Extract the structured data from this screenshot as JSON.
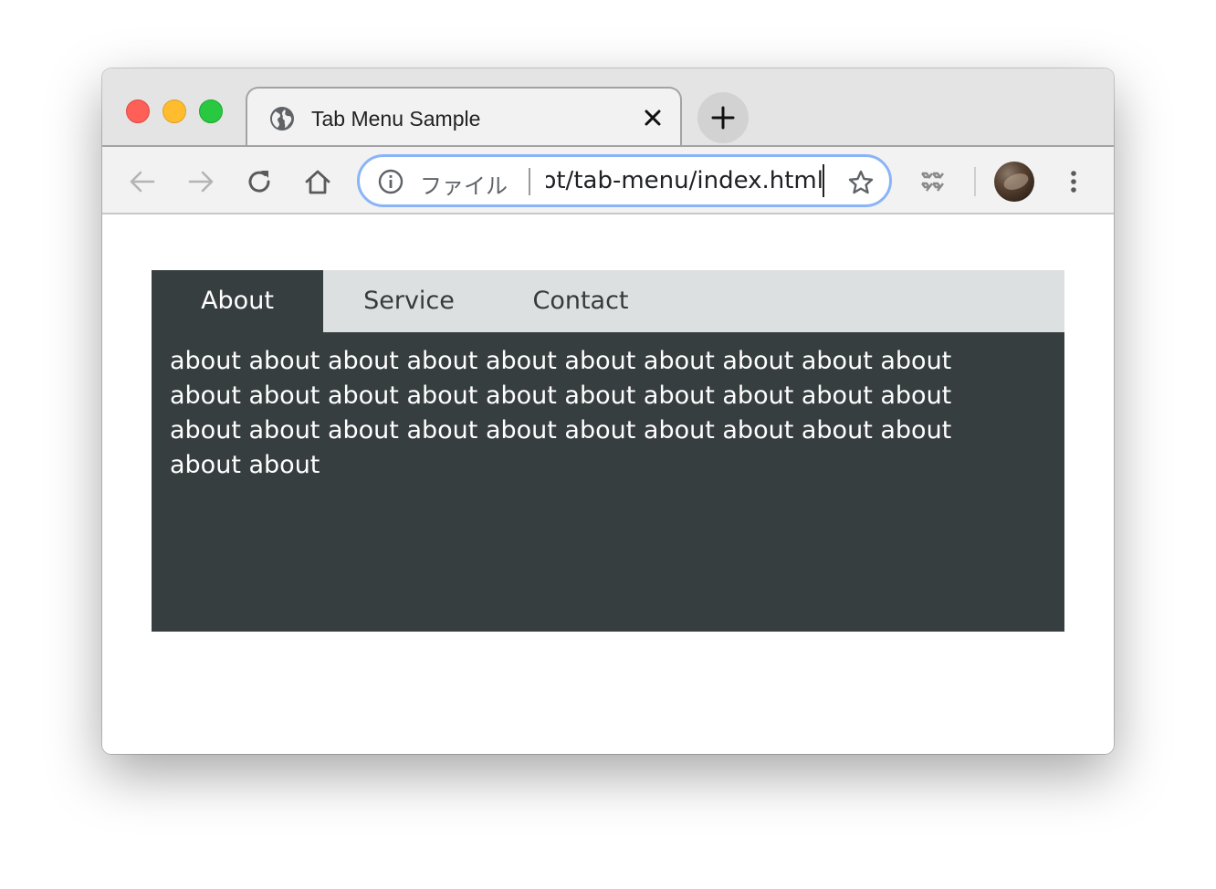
{
  "browser": {
    "tab_title": "Tab Menu Sample",
    "omnibox": {
      "scheme_label": "ファイル",
      "url_visible": "ot/tab-menu/index.html"
    }
  },
  "colors": {
    "tab_active_bg": "#373e40",
    "tab_bar_bg": "#dde0e1",
    "omnibox_focus": "#8ab4f8"
  },
  "icons": {
    "tab_favicon": "globe-icon",
    "tab_close": "close-icon",
    "new_tab": "plus-icon",
    "back": "arrow-left-icon",
    "forward": "arrow-right-icon",
    "reload": "reload-icon",
    "home": "home-icon",
    "info": "info-icon",
    "bookmark": "star-icon",
    "extension": "extension-icon",
    "menu": "kebab-menu-icon"
  },
  "tabmenu": {
    "tabs": [
      {
        "label": "About",
        "active": true
      },
      {
        "label": "Service",
        "active": false
      },
      {
        "label": "Contact",
        "active": false
      }
    ],
    "panel_text": "about about about about about about about about about about about about about about about about about about about about about about about about about about about about about about about about"
  }
}
